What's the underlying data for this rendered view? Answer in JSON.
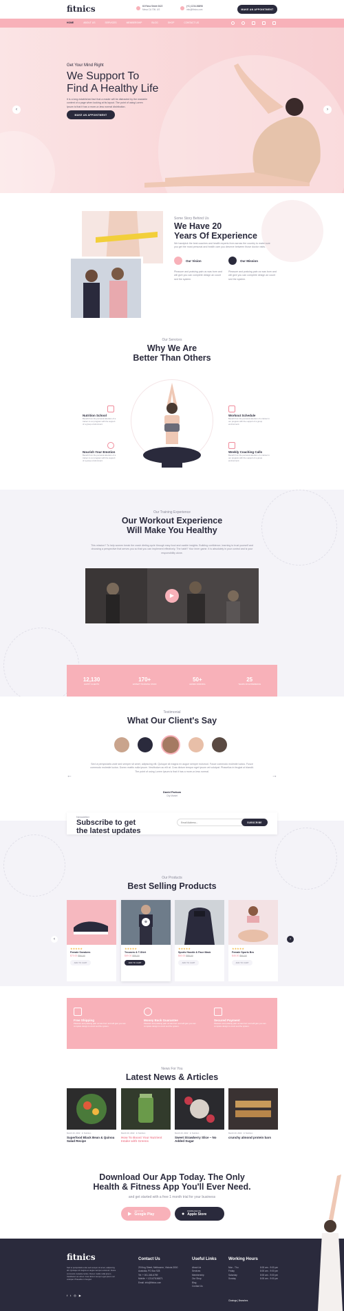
{
  "header": {
    "logo": "fitnics",
    "address_1": "60 Rena Street 0622",
    "address_2": "Mesa CA 70ft, US",
    "phone_1": "(+1) 1234-56898",
    "phone_2": "info@fitnics.com",
    "cta": "MAKE AN APPOINTMENT"
  },
  "nav": {
    "items": [
      "HOME",
      "ABOUT US",
      "SERVICES",
      "MEMBERSHIP",
      "BLOG",
      "SHOP",
      "CONTACT US"
    ]
  },
  "hero": {
    "kicker": "Get Your Mind Right",
    "title_1": "We Support To",
    "title_2": "Find A Healthy Life",
    "text": "It is a long established fact that a reader will be distracted by the readable content of a page when looking at its layout. The point of using Lorem Ipsum is that it has a more-or-less normal distribution.",
    "button": "MAKE AN APPOINTMENT"
  },
  "about": {
    "kicker": "Some Story Behind Us",
    "title_1": "We Have 20",
    "title_2": "Years Of Experience",
    "text": "We handpick the best coaches and health experts from across the country to make sure you get the most personal and health care you deserve between those doctor visits.",
    "vision_label": "Our Vision",
    "mission_label": "Our Mission",
    "vision_text": "Pleasure and praising pain us was born and will give you can complete design an count sed the system.",
    "mission_text": "Pleasure and praising pain us was born and will give you can complete design an count sed the system."
  },
  "services": {
    "kicker": "Our Services",
    "title_1": "Why We Are",
    "title_2": "Better Than Others",
    "items": [
      {
        "title": "Nutrition School",
        "text": "Benefit from the personal attention of a trainer in our program with the support of a group environment."
      },
      {
        "title": "Nourish Your Emotion",
        "text": "Benefit from the personal attention of a trainer in our program with the support of a group environment."
      },
      {
        "title": "Workout Schedule",
        "text": "Benefit from the personal attention of a trainer in our program with the support of a group environment."
      },
      {
        "title": "Weekly Coaching Calls",
        "text": "Benefit from the personal attention of a trainer in our program with the support of a group environment."
      }
    ]
  },
  "training": {
    "kicker": "Our Training Experience",
    "title_1": "Our Workout Experience",
    "title_2": "Will Make You Healthy",
    "text": "This mission? To help women break the crash dieting cycle through easy food and usable insights. Building confidence, learning to trust yourself and choosing a perspective that serves you so that you can implement effectively. The habit? Your inner game. It is absolutely in your control and is your responsibility alone."
  },
  "stats": [
    {
      "value": "12,130",
      "label": "HAPPY CLIENTS"
    },
    {
      "value": "170+",
      "label": "EXPERT TRAINING STAFF"
    },
    {
      "value": "50+",
      "label": "AWARD WINNING"
    },
    {
      "value": "25",
      "label": "YEARS OF EXPERIENCE"
    }
  ],
  "testimonial": {
    "kicker": "Testimonial",
    "title": "What Our Client's Say",
    "quote": "Sed ut perspiciatis unde sed semper sit amet, adipiscing elit. Quisque sit magna ex augue semper euismod. Fusce commodo molestie luctus. Fusce commodo molestie luctus. Donec mattis nulla ipsum. Vestibulum ac elit at. Cras dictum tempor eget ipsum vel volutpat. Phasellus in feugiat ut blandit. The point of using Lorem Ipsum is that it has a more-or-less normal.",
    "name": "David Parkow",
    "role": "City Market"
  },
  "newsletter": {
    "kicker": "Newsletter",
    "title_1": "Subscribe to get",
    "title_2": "the latest updates",
    "placeholder": "Email Address...",
    "button": "SUBSCRIBE"
  },
  "products": {
    "kicker": "Our Products",
    "title": "Best Selling Products",
    "stars": "★★★★★",
    "add_label": "ADD TO CART",
    "items": [
      {
        "name": "Female Sneakers",
        "price": "$70.00",
        "old": "$90.00"
      },
      {
        "name": "Trousers & T-Shirt",
        "price": "$69.00",
        "old": "$89.00"
      },
      {
        "name": "Sports Hoodie & Face Mask",
        "price": "$60.00",
        "old": "$85.00"
      },
      {
        "name": "Female Sports Bra",
        "price": "$45.00",
        "old": "$60.00"
      }
    ]
  },
  "features": [
    {
      "title": "Free Shipping",
      "text": "Pleasure and praising pain us was born and will give you can complete design to count sed the system."
    },
    {
      "title": "Money Back Guarantee",
      "text": "Pleasure and praising pain us was born and will give you can complete design to count sed the system."
    },
    {
      "title": "Secured Payment",
      "text": "Pleasure and praising pain us was born and will give you can complete design to count sed the system."
    }
  ],
  "news": {
    "kicker": "News For You",
    "title": "Latest News & Articles",
    "items": [
      {
        "date": "March 20, 2022",
        "category": "In Nutrition",
        "title": "Superfood Black Bean & Quinoa Salad Recipe"
      },
      {
        "date": "March 20, 2022",
        "category": "In Nutrition",
        "title": "How To Boost Your Nutrient Intake with Greens"
      },
      {
        "date": "March 20, 2022",
        "category": "In Nutrition",
        "title": "Sweet Strawberry Slice – No Added Sugar"
      },
      {
        "date": "March 20, 2022",
        "category": "In Nutrition",
        "title": "crunchy almond protein bars"
      }
    ]
  },
  "app": {
    "title_1": "Download Our App Today. The Only",
    "title_2": "Health & Fitness App You'll Ever Need.",
    "text": "and get started with a free 1 month trial for your business",
    "google_small": "GET IT ON",
    "google_big": "Google Play",
    "apple_small": "DOWNLOAD ON",
    "apple_big": "Apple Store"
  },
  "footer": {
    "logo": "fitnics",
    "about": "Sed ut perspiciatis unde sed semper sit amet, adipiscing elit. Quisque sit magna ex augue semper euismod. Fusce commodo molestie luctus. Donec mattis nulla ipsum. Vestibulum ac elit at. Cras dictum tempor eget ipsum vel volutpat. Phasellus in feugiat.",
    "contact_title": "Contact Us",
    "contact": [
      "29 King Street, Melbourne, Victoria 3000",
      "Australia, PO Box 928",
      "Tel: + 001-345-6789",
      "Mobile: + 123-678-56871",
      "Email: info@fitnics.com"
    ],
    "links_title": "Useful Links",
    "links": [
      "About Us",
      "Services",
      "Membership",
      "Our Shop",
      "Blog",
      "Contact Us"
    ],
    "hours_title": "Working Hours",
    "hours": [
      {
        "day": "Mon - Thu",
        "time": "8:00 am - 9:00 pm"
      },
      {
        "day": "Friday",
        "time": "8:00 am - 9:00 pm"
      },
      {
        "day": "Saturday",
        "time": "8:00 am - 9:00 pm"
      },
      {
        "day": "Sunday",
        "time": "8:00 am - 9:00 pm"
      }
    ],
    "bottom": "Closings  |  Branches"
  },
  "colors": {
    "accent": "#f8b1b9",
    "dark": "#2a2a3c",
    "pink_text": "#f08a9a",
    "bg_light": "#f4f3f8"
  }
}
